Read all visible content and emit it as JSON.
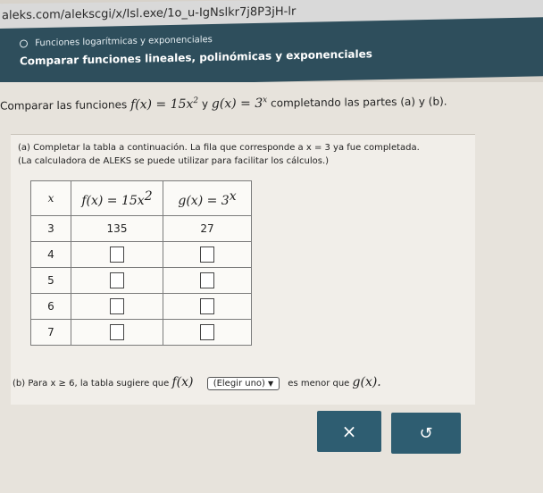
{
  "browser": {
    "url": "aleks.com/alekscgi/x/Isl.exe/1o_u-IgNslkr7j8P3jH-lr"
  },
  "header": {
    "subtitle": "Funciones logarítmicas y exponenciales",
    "title": "Comparar funciones lineales, polinómicas y exponenciales"
  },
  "prompt": {
    "lead": "Comparar las funciones",
    "f_def": "f(x) = 15x",
    "f_exp": "2",
    "y": "y",
    "g_def": "g(x) = 3",
    "g_exp": "x",
    "tail": "completando las partes (a) y (b)."
  },
  "part_a": {
    "line1": "(a) Completar la tabla a continuación. La fila que corresponde a x = 3 ya fue completada.",
    "line2": "(La calculadora de ALEKS se puede utilizar para facilitar los cálculos.)"
  },
  "table": {
    "headers": {
      "x": "x",
      "f": "f(x) = 15x",
      "f_exp": "2",
      "g": "g(x) = 3",
      "g_exp": "x"
    },
    "rows": [
      {
        "x": "3",
        "f": "135",
        "g": "27"
      },
      {
        "x": "4",
        "f": "",
        "g": ""
      },
      {
        "x": "5",
        "f": "",
        "g": ""
      },
      {
        "x": "6",
        "f": "",
        "g": ""
      },
      {
        "x": "7",
        "f": "",
        "g": ""
      }
    ]
  },
  "part_b": {
    "lead": "(b) Para x ≥ 6, la tabla sugiere que",
    "f": "f(x)",
    "dropdown": "(Elegir uno)",
    "tail": "es menor que",
    "g": "g(x)."
  },
  "buttons": {
    "clear": "×",
    "undo": "↺"
  }
}
